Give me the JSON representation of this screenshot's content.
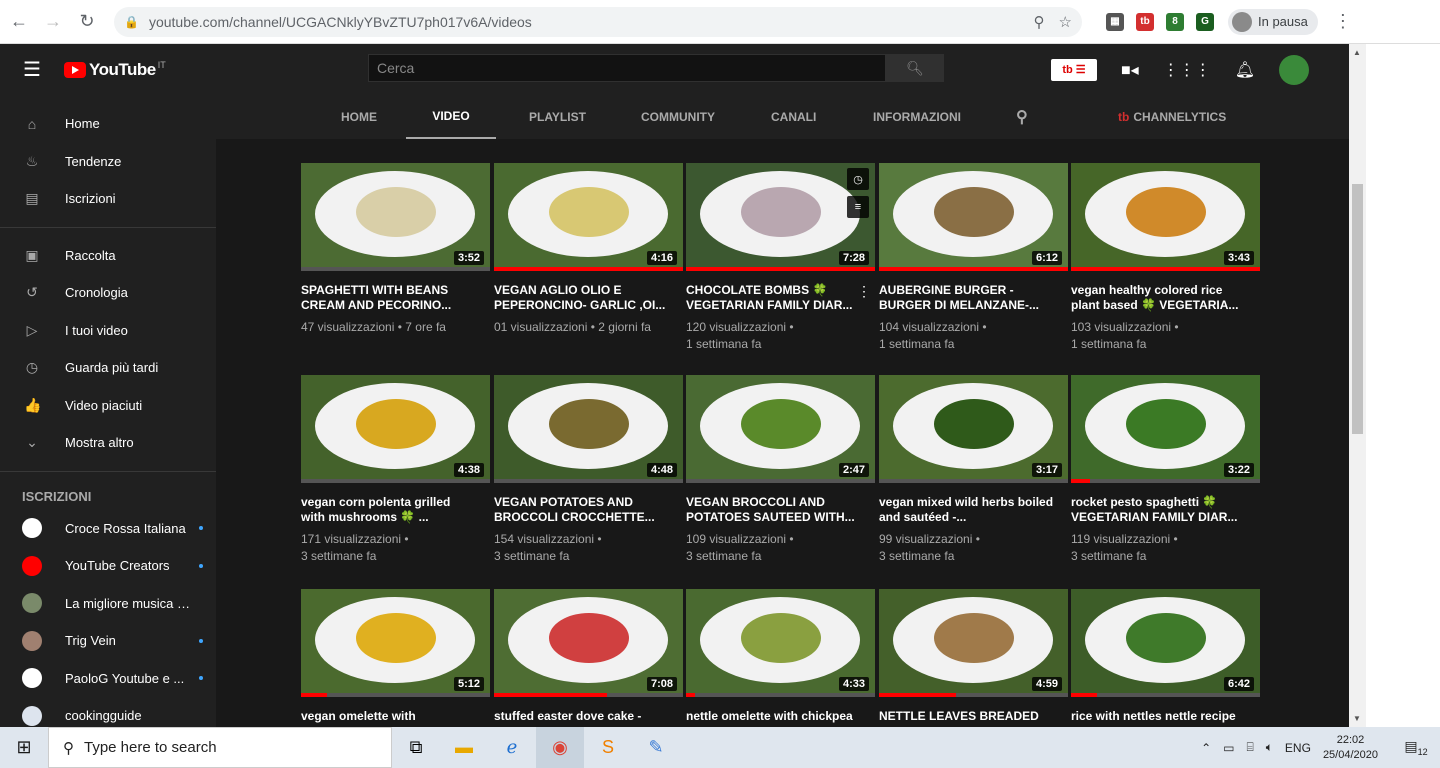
{
  "browser": {
    "url": "youtube.com/channel/UCGACNklyYBvZTU7ph017v6A/videos",
    "profile_status": "In pausa"
  },
  "masthead": {
    "logo_text": "YouTube",
    "region": "IT",
    "search_placeholder": "Cerca",
    "tb_label": "tb"
  },
  "sidebar": {
    "items": [
      {
        "label": "Home",
        "icon": "home-icon",
        "glyph": "⌂"
      },
      {
        "label": "Tendenze",
        "icon": "flame-icon",
        "glyph": "♨"
      },
      {
        "label": "Iscrizioni",
        "icon": "subscriptions-icon",
        "glyph": "▤"
      }
    ],
    "library": [
      {
        "label": "Raccolta",
        "icon": "library-icon",
        "glyph": "▣"
      },
      {
        "label": "Cronologia",
        "icon": "history-icon",
        "glyph": "↺"
      },
      {
        "label": "I tuoi video",
        "icon": "your-videos-icon",
        "glyph": "▷"
      },
      {
        "label": "Guarda più tardi",
        "icon": "watch-later-icon",
        "glyph": "◷"
      },
      {
        "label": "Video piaciuti",
        "icon": "thumbs-up-icon",
        "glyph": "👍"
      },
      {
        "label": "Mostra altro",
        "icon": "chevron-down-icon",
        "glyph": "⌄"
      }
    ],
    "subs_heading": "ISCRIZIONI",
    "subscriptions": [
      {
        "name": "Croce Rossa Italiana",
        "color": "#ffffff",
        "new": true
      },
      {
        "name": "YouTube Creators",
        "color": "#ff0000",
        "new": true
      },
      {
        "name": "La migliore musica st...",
        "color": "#7a8a6a",
        "new": false
      },
      {
        "name": "Trig Vein",
        "color": "#a08070",
        "new": true
      },
      {
        "name": "PaoloG Youtube e ...",
        "color": "#ffffff",
        "new": true
      },
      {
        "name": "cookingguide",
        "color": "#dde4ee",
        "new": false
      }
    ]
  },
  "tabs": [
    "HOME",
    "VIDEO",
    "PLAYLIST",
    "COMMUNITY",
    "CANALI",
    "INFORMAZIONI"
  ],
  "active_tab": "VIDEO",
  "channelytics_label": "CHANNELYTICS",
  "videos": [
    {
      "title": "SPAGHETTI WITH BEANS CREAM AND PECORINO...",
      "views": "47 visualizzazioni",
      "age": "7 ore fa",
      "duration": "3:52",
      "progress": 0.0,
      "bg": "#4c6b33",
      "food": "#d9cfa8"
    },
    {
      "title": "VEGAN AGLIO OLIO E PEPERONCINO- GARLIC ,OI...",
      "views": "01 visualizzazioni",
      "age": "2 giorni fa",
      "duration": "4:16",
      "progress": 1.0,
      "bg": "#4a6a30",
      "food": "#d8c873"
    },
    {
      "title": "CHOCOLATE BOMBS 🍀 VEGETARIAN FAMILY DIAR...",
      "views": "120 visualizzazioni",
      "age": "1 settimana fa",
      "duration": "7:28",
      "progress": 1.0,
      "bg": "#3c5830",
      "food": "#b9a7b0"
    },
    {
      "title": "AUBERGINE BURGER - BURGER DI MELANZANE-...",
      "views": "104 visualizzazioni",
      "age": "1 settimana fa",
      "duration": "6:12",
      "progress": 1.0,
      "bg": "#587a3e",
      "food": "#8a6f45"
    },
    {
      "title": "vegan healthy colored rice plant based 🍀 VEGETARIA...",
      "views": "103 visualizzazioni",
      "age": "1 settimana fa",
      "duration": "3:43",
      "progress": 1.0,
      "bg": "#466628",
      "food": "#d08a2a"
    },
    {
      "title": "vegan corn polenta grilled with mushrooms 🍀 ...",
      "views": "171 visualizzazioni",
      "age": "3 settimane fa",
      "duration": "4:38",
      "progress": 0.0,
      "bg": "#44622b",
      "food": "#d8a820"
    },
    {
      "title": "VEGAN POTATOES AND BROCCOLI CROCCHETTE...",
      "views": "154 visualizzazioni",
      "age": "3 settimane fa",
      "duration": "4:48",
      "progress": 0.0,
      "bg": "#3e5b2a",
      "food": "#7a6a30"
    },
    {
      "title": "VEGAN BROCCOLI AND POTATOES SAUTEED WITH...",
      "views": "109 visualizzazioni",
      "age": "3 settimane fa",
      "duration": "2:47",
      "progress": 0.0,
      "bg": "#4a6a33",
      "food": "#5a8a2a"
    },
    {
      "title": "vegan mixed wild herbs boiled and sautéed -...",
      "views": "99 visualizzazioni",
      "age": "3 settimane fa",
      "duration": "3:17",
      "progress": 0.0,
      "bg": "#4c6b2e",
      "food": "#2f5a1a"
    },
    {
      "title": "rocket pesto spaghetti 🍀 VEGETARIAN FAMILY DIAR...",
      "views": "119 visualizzazioni",
      "age": "3 settimane fa",
      "duration": "3:22",
      "progress": 0.1,
      "bg": "#3f6a2a",
      "food": "#3b7a25"
    },
    {
      "title": "vegan omelette with",
      "views": "",
      "age": "",
      "duration": "5:12",
      "progress": 0.14,
      "bg": "#4b6a2e",
      "food": "#e0b020"
    },
    {
      "title": "stuffed easter dove cake -",
      "views": "",
      "age": "",
      "duration": "7:08",
      "progress": 0.6,
      "bg": "#4e6d33",
      "food": "#d04040"
    },
    {
      "title": "nettle omelette with chickpea",
      "views": "",
      "age": "",
      "duration": "4:33",
      "progress": 0.05,
      "bg": "#4a6a30",
      "food": "#8aa040"
    },
    {
      "title": "NETTLE LEAVES BREADED",
      "views": "",
      "age": "",
      "duration": "4:59",
      "progress": 0.41,
      "bg": "#44602a",
      "food": "#a07a4a"
    },
    {
      "title": "rice with nettles nettle recipe",
      "views": "",
      "age": "",
      "duration": "6:42",
      "progress": 0.14,
      "bg": "#3d5d28",
      "food": "#3f7a2a"
    }
  ],
  "taskbar": {
    "search_placeholder": "Type here to search",
    "lang": "ENG",
    "time": "22:02",
    "date": "25/04/2020",
    "notifications": "12"
  }
}
